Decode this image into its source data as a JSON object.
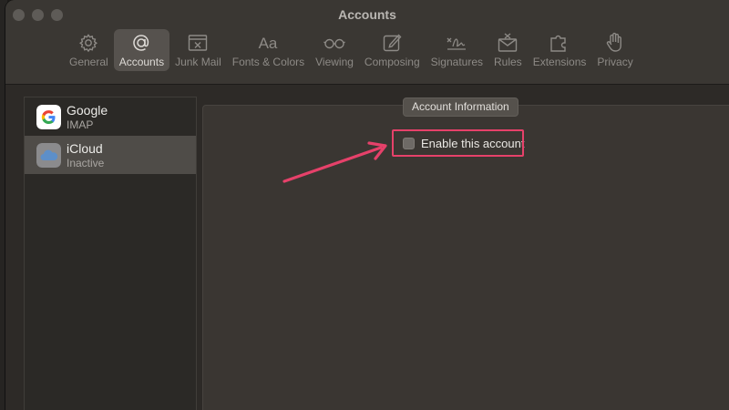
{
  "window": {
    "title": "Accounts"
  },
  "toolbar": {
    "items": [
      {
        "label": "General",
        "icon": "gear-icon"
      },
      {
        "label": "Accounts",
        "icon": "at-sign-icon",
        "active": true
      },
      {
        "label": "Junk Mail",
        "icon": "junk-mail-icon"
      },
      {
        "label": "Fonts & Colors",
        "icon": "fonts-icon",
        "glyph": "Aa"
      },
      {
        "label": "Viewing",
        "icon": "glasses-icon"
      },
      {
        "label": "Composing",
        "icon": "compose-icon"
      },
      {
        "label": "Signatures",
        "icon": "signature-icon"
      },
      {
        "label": "Rules",
        "icon": "rules-icon"
      },
      {
        "label": "Extensions",
        "icon": "puzzle-icon"
      },
      {
        "label": "Privacy",
        "icon": "hand-icon"
      }
    ]
  },
  "accounts": [
    {
      "name": "Google",
      "type": "IMAP",
      "icon": "google-icon"
    },
    {
      "name": "iCloud",
      "type": "Inactive",
      "icon": "icloud-icon",
      "selected": true
    }
  ],
  "panel": {
    "section_title": "Account Information",
    "enable_label": "Enable this account",
    "enable_checked": false
  },
  "colors": {
    "highlight": "#e6416a",
    "window_bg": "#2d2a27",
    "toolbar_active": "#56524e"
  }
}
